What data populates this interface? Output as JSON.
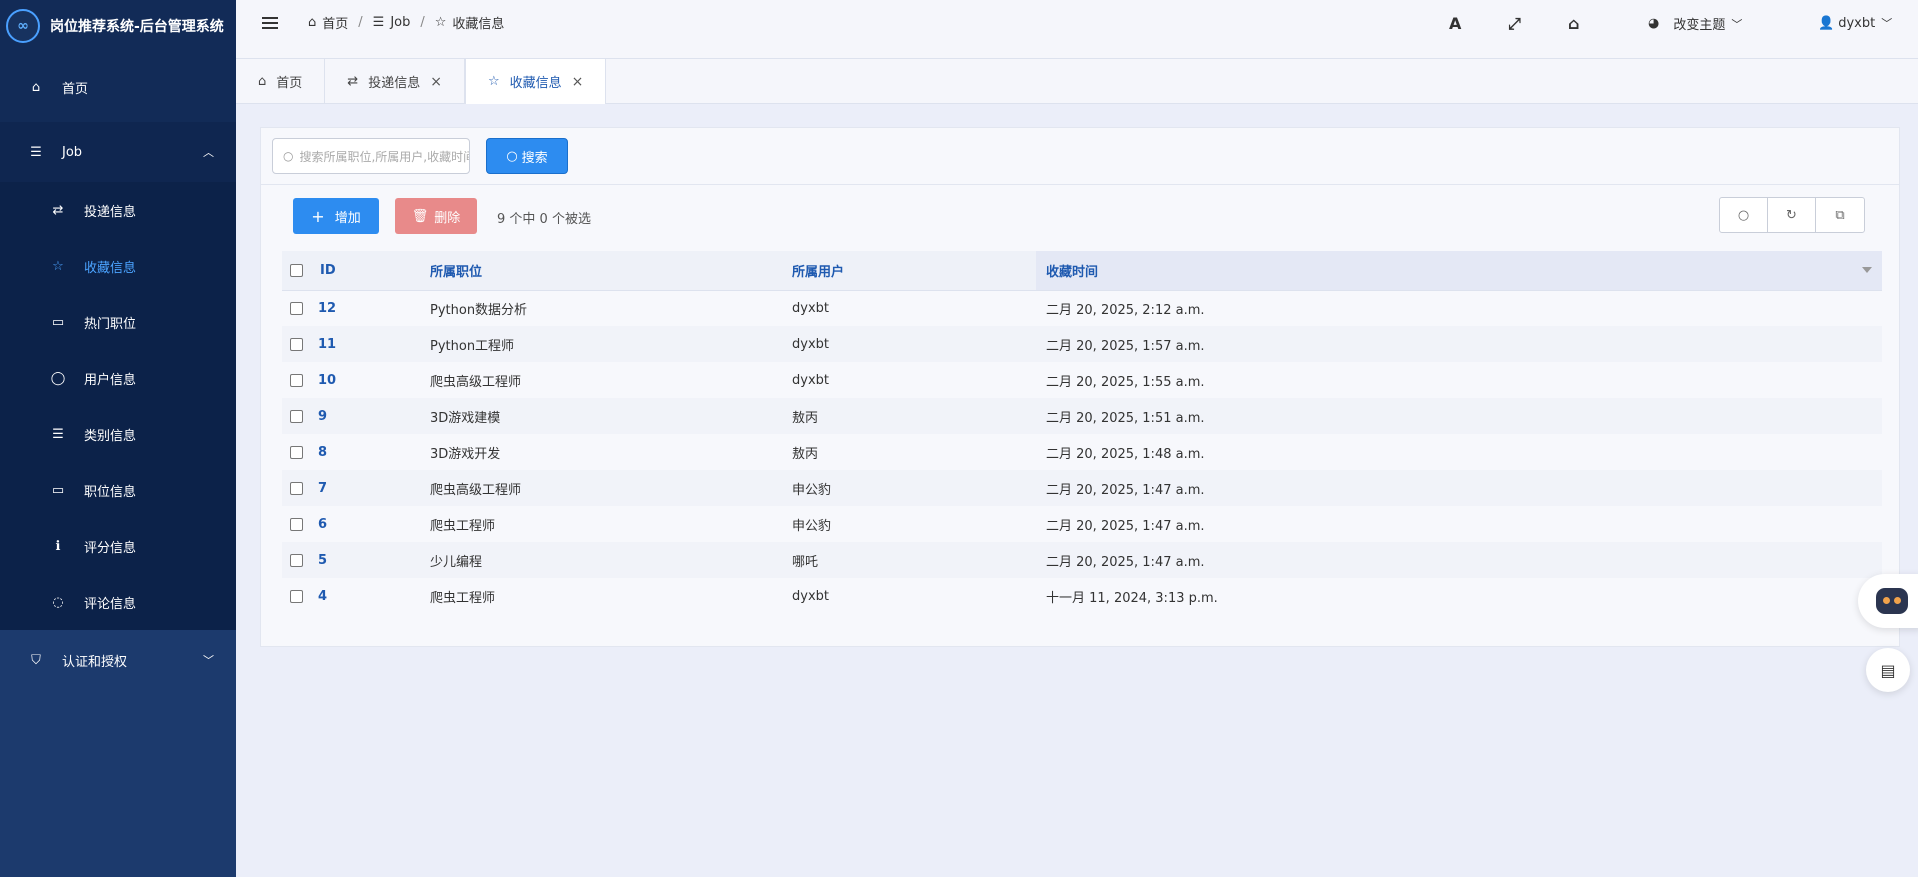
{
  "brand": {
    "logo_glyph": "∞",
    "title": "岗位推荐系统-后台管理系统"
  },
  "sidebar": {
    "home": {
      "icon": "home-icon",
      "label": "首页"
    },
    "job_group": {
      "icon": "list-icon",
      "label": "Job",
      "expanded": true
    },
    "job_items": [
      {
        "icon": "retweet-icon",
        "label": "投递信息",
        "active": false
      },
      {
        "icon": "star-icon",
        "label": "收藏信息",
        "active": true
      },
      {
        "icon": "monitor-icon",
        "label": "热门职位",
        "active": false
      },
      {
        "icon": "user-icon",
        "label": "用户信息",
        "active": false
      },
      {
        "icon": "list-icon",
        "label": "类别信息",
        "active": false
      },
      {
        "icon": "monitor-icon",
        "label": "职位信息",
        "active": false
      },
      {
        "icon": "info-icon",
        "label": "评分信息",
        "active": false
      },
      {
        "icon": "comment-icon",
        "label": "评论信息",
        "active": false
      }
    ],
    "auth_group": {
      "icon": "shield-icon",
      "label": "认证和授权",
      "expanded": false
    }
  },
  "header": {
    "breadcrumb": [
      {
        "icon": "home-icon",
        "label": "首页"
      },
      {
        "icon": "list-icon",
        "label": "Job"
      },
      {
        "icon": "star-icon",
        "label": "收藏信息"
      }
    ],
    "font_icon_glyph": "A",
    "theme_label": "改变主题",
    "user_label": "dyxbt"
  },
  "tabs": [
    {
      "icon": "home-icon",
      "label": "首页",
      "closable": false,
      "active": false
    },
    {
      "icon": "retweet-icon",
      "label": "投递信息",
      "closable": true,
      "active": false
    },
    {
      "icon": "star-icon",
      "label": "收藏信息",
      "closable": true,
      "active": true
    }
  ],
  "search": {
    "placeholder": "搜索所属职位,所属用户,收藏时间",
    "button_label": "搜索"
  },
  "toolbar": {
    "add_label": "增加",
    "delete_label": "删除",
    "selection_text": "9 个中 0 个被选"
  },
  "table": {
    "columns": [
      "ID",
      "所属职位",
      "所属用户",
      "收藏时间"
    ],
    "rows": [
      {
        "id": "12",
        "job": "Python数据分析",
        "user": "dyxbt",
        "time": "二月 20, 2025, 2:12 a.m."
      },
      {
        "id": "11",
        "job": "Python工程师",
        "user": "dyxbt",
        "time": "二月 20, 2025, 1:57 a.m."
      },
      {
        "id": "10",
        "job": "爬虫高级工程师",
        "user": "dyxbt",
        "time": "二月 20, 2025, 1:55 a.m."
      },
      {
        "id": "9",
        "job": "3D游戏建模",
        "user": "敖丙",
        "time": "二月 20, 2025, 1:51 a.m."
      },
      {
        "id": "8",
        "job": "3D游戏开发",
        "user": "敖丙",
        "time": "二月 20, 2025, 1:48 a.m."
      },
      {
        "id": "7",
        "job": "爬虫高级工程师",
        "user": "申公豹",
        "time": "二月 20, 2025, 1:47 a.m."
      },
      {
        "id": "6",
        "job": "爬虫工程师",
        "user": "申公豹",
        "time": "二月 20, 2025, 1:47 a.m."
      },
      {
        "id": "5",
        "job": "少儿编程",
        "user": "哪吒",
        "time": "二月 20, 2025, 1:47 a.m."
      },
      {
        "id": "4",
        "job": "爬虫工程师",
        "user": "dyxbt",
        "time": "十一月 11, 2024, 3:13 p.m."
      }
    ]
  },
  "colors": {
    "sidebar_bg": "#1c3a6d",
    "accent": "#2d8cf0",
    "danger": "#e88a8a",
    "active_link": "#4ba3ff"
  }
}
